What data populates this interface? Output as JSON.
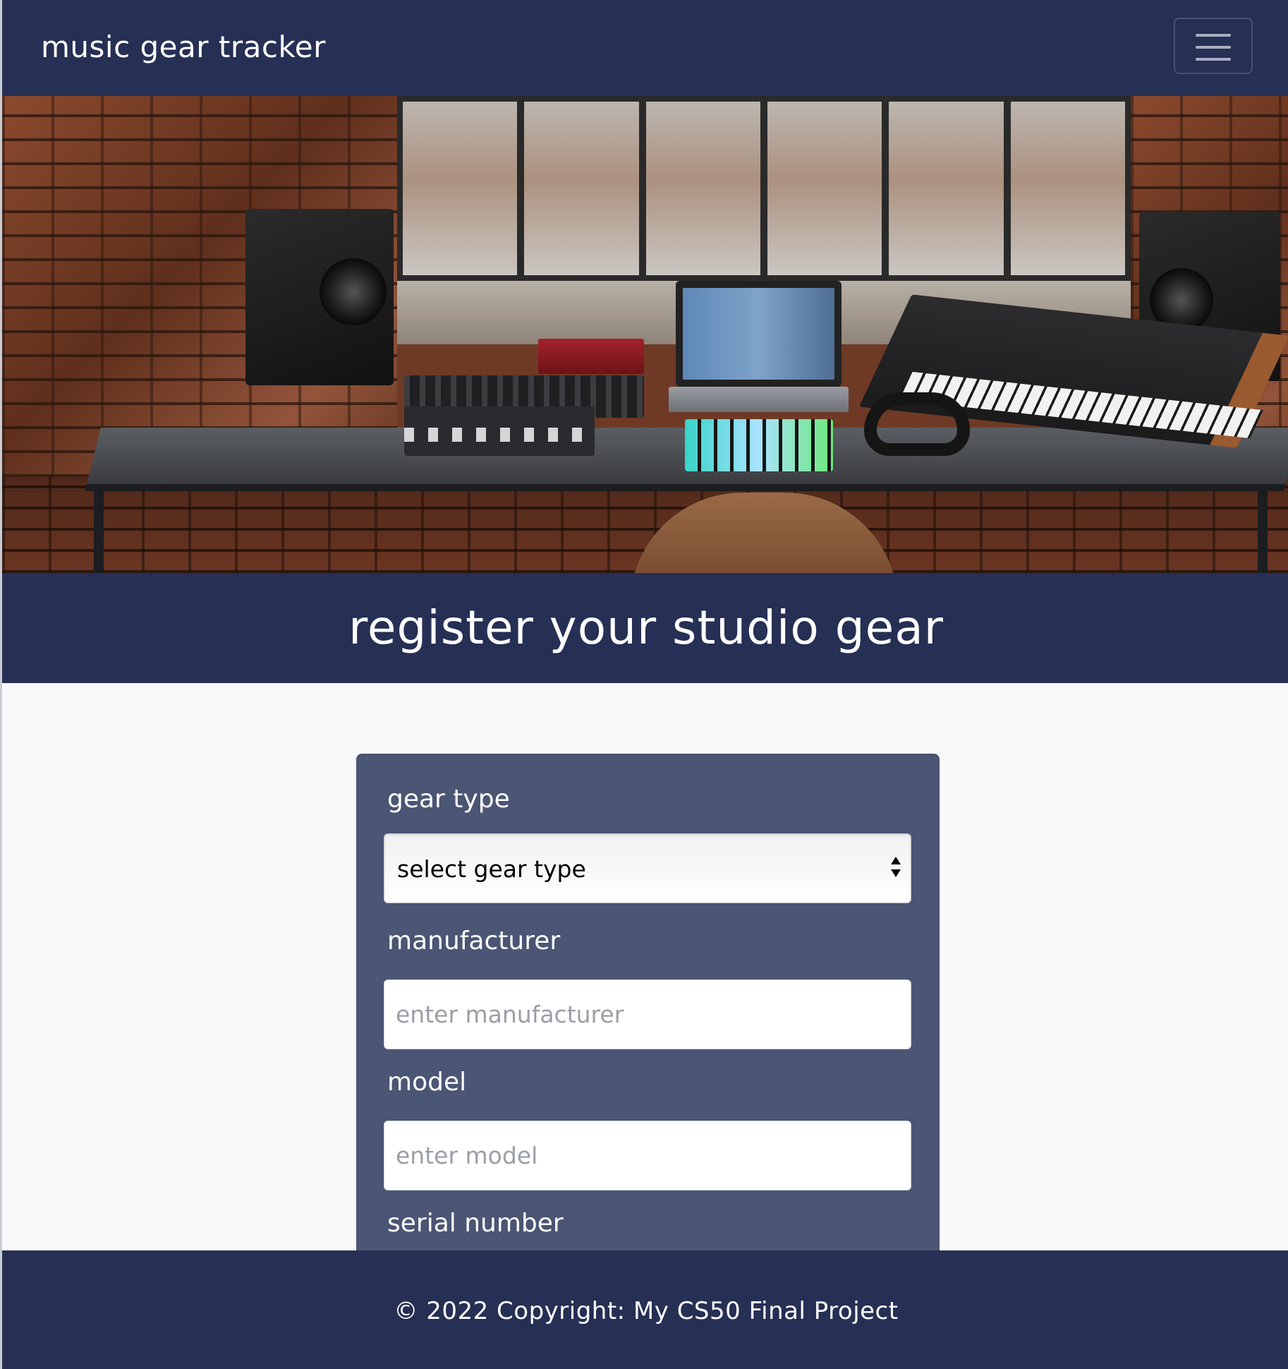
{
  "navbar": {
    "brand": "music gear tracker",
    "toggler_icon": "hamburger-menu-icon"
  },
  "hero": {
    "image": "studio desk with monitors, laptop, synthesizers and brick wall"
  },
  "header": {
    "title": "register your studio gear"
  },
  "form": {
    "gear_type": {
      "label": "gear type",
      "selected": "select gear type"
    },
    "manufacturer": {
      "label": "manufacturer",
      "placeholder": "enter manufacturer"
    },
    "model": {
      "label": "model",
      "placeholder": "enter model"
    },
    "serial_number": {
      "label": "serial number"
    }
  },
  "footer": {
    "copyright": "© 2022 Copyright: My CS50 Final Project"
  },
  "colors": {
    "navbar_bg": "#262f54",
    "form_card_bg": "#4b5574",
    "page_bg": "#f8f9fa"
  }
}
